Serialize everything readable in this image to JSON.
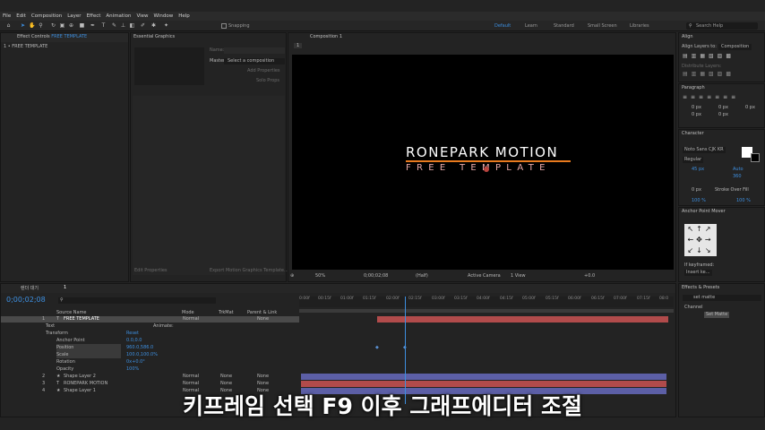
{
  "menu": [
    "File",
    "Edit",
    "Composition",
    "Layer",
    "Effect",
    "Animation",
    "View",
    "Window",
    "Help"
  ],
  "toolbar": {
    "snapping": "Snapping",
    "workspaces": [
      "Default",
      "Learn",
      "Standard",
      "Small Screen",
      "Libraries"
    ],
    "search_placeholder": "Search Help"
  },
  "effect_controls": {
    "tab": "Effect Controls",
    "layer": "FREE TEMPLATE",
    "path": "1 • FREE TEMPLATE"
  },
  "essential_graphics": {
    "tab": "Essential Graphics",
    "name_label": "Name:",
    "master_label": "Master:",
    "master_value": "Select a composition",
    "btn_add": "Add Properties",
    "btn_solo": "Solo Props",
    "btn_export": "Export Motion Graphics Template...",
    "btn_edit": "Edit Properties"
  },
  "composition": {
    "tab": "Composition 1",
    "breadcrumb": "1",
    "title_text": "RONEPARK MOTION",
    "subtitle_text": "FREE TEMPLATE",
    "zoom": "50%",
    "timecode": "0;00;02;08",
    "resolution": "(Half)",
    "camera": "Active Camera",
    "views": "1 View",
    "exposure": "+0.0",
    "accent": "#e87a1e"
  },
  "align": {
    "title": "Align",
    "align_to_label": "Align Layers to:",
    "align_to_value": "Composition",
    "distribute": "Distribute Layers:"
  },
  "paragraph": {
    "title": "Paragraph",
    "values": [
      "0 px",
      "0 px",
      "0 px",
      "0 px",
      "0 px"
    ]
  },
  "character": {
    "title": "Character",
    "font": "Noto Sans CJK KR",
    "style": "Regular",
    "size": "45 px",
    "tracking": "Auto",
    "leading": "360",
    "stroke": "0 px",
    "stroke_mode": "Stroke Over Fill",
    "scale_v": "100 %",
    "scale_h": "100 %"
  },
  "anchor_mover": {
    "title": "Anchor Point Mover",
    "if_keyframed": "If keyframed:",
    "insert": "Insert ke..."
  },
  "effects_presets": {
    "title": "Effects & Presets",
    "search": "set matte",
    "group": "Channel",
    "item": "Set Matte"
  },
  "timeline": {
    "tabs": [
      "렌더 대기",
      "1"
    ],
    "timecode": "0;00;02;08",
    "search_placeholder": "",
    "headers": {
      "source": "Source Name",
      "mode": "Mode",
      "trkmat": "TrkMat",
      "parent": "Parent & Link"
    },
    "ruler": [
      "0:00f",
      "00:15f",
      "01:00f",
      "01:15f",
      "02:00f",
      "02:15f",
      "03:00f",
      "03:15f",
      "04:00f",
      "04:15f",
      "05:00f",
      "05:15f",
      "06:00f",
      "06:15f",
      "07:00f",
      "07:15f",
      "08:0"
    ],
    "layers": [
      {
        "num": "1",
        "type": "T",
        "name": "FREE TEMPLATE",
        "mode": "Normal",
        "trkmat": "",
        "parent": "None"
      },
      {
        "num": "2",
        "type": "★",
        "name": "Shape Layer 2",
        "mode": "Normal",
        "trkmat": "None",
        "parent": "None"
      },
      {
        "num": "3",
        "type": "T",
        "name": "RONEPARK MOTION",
        "mode": "Normal",
        "trkmat": "None",
        "parent": "None"
      },
      {
        "num": "4",
        "type": "★",
        "name": "Shape Layer 1",
        "mode": "Normal",
        "trkmat": "None",
        "parent": "None"
      }
    ],
    "props": {
      "text": "Text",
      "animate": "Animate:",
      "transform": "Transform",
      "reset": "Reset",
      "anchor": "Anchor Point",
      "anchor_val": "0.0,0.0",
      "position": "Position",
      "position_val": "960.0,586.0",
      "scale": "Scale",
      "scale_val": "100.0,100.0%",
      "rotation": "Rotation",
      "rotation_val": "0x+0.0°",
      "opacity": "Opacity",
      "opacity_val": "100%"
    }
  },
  "caption": "키프레임 선택 F9 이후 그래프에디터 조절"
}
